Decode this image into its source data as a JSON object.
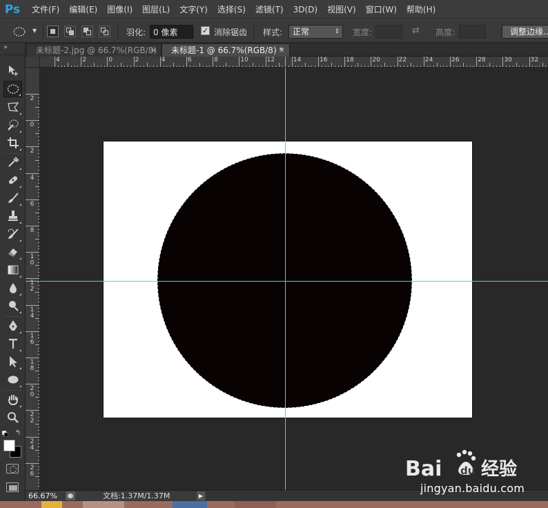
{
  "app": {
    "logo": "Ps"
  },
  "menu": [
    "文件(F)",
    "编辑(E)",
    "图像(I)",
    "图层(L)",
    "文字(Y)",
    "选择(S)",
    "滤镜(T)",
    "3D(D)",
    "视图(V)",
    "窗口(W)",
    "帮助(H)"
  ],
  "options": {
    "feather_label": "羽化:",
    "feather_value": "0 像素",
    "antialias_label": "消除锯齿",
    "antialias_checked": true,
    "style_label": "样式:",
    "style_value": "正常",
    "width_label": "宽度:",
    "height_label": "高度:",
    "refine_label": "调整边缘..."
  },
  "tabs": [
    {
      "label": "未标题-2.jpg @ 66.7%(RGB/8)",
      "active": false
    },
    {
      "label": "未标题-1 @ 66.7%(RGB/8) *",
      "active": true
    }
  ],
  "ruler": {
    "h_labels": [
      "4",
      "2",
      "0",
      "2",
      "4",
      "6",
      "8",
      "10",
      "12",
      "14",
      "16",
      "18",
      "20",
      "22",
      "24",
      "26",
      "28",
      "30",
      "32"
    ],
    "v_labels": [
      "2",
      "0",
      "2",
      "4",
      "6",
      "8",
      "10",
      "12",
      "14",
      "16",
      "18",
      "20",
      "22",
      "24",
      "26"
    ]
  },
  "statusbar": {
    "zoom": "66.67%",
    "doc_info": "文档:1.37M/1.37M"
  },
  "colors": {
    "foreground": "#ffffff",
    "background": "#000000",
    "guide": "#3fd6e6",
    "shape_fill": "#080202"
  },
  "watermark": {
    "logo_text": "Bai du 经验",
    "url": "jingyan.baidu.com"
  },
  "icons": {
    "tools": [
      "move-icon",
      "elliptical-marquee-icon",
      "lasso-icon",
      "quick-selection-icon",
      "crop-icon",
      "eyedropper-icon",
      "healing-brush-icon",
      "brush-icon",
      "clone-stamp-icon",
      "history-brush-icon",
      "eraser-icon",
      "gradient-icon",
      "blur-icon",
      "dodge-icon",
      "pen-icon",
      "type-icon",
      "path-selection-icon",
      "ellipse-shape-icon",
      "hand-icon",
      "zoom-icon"
    ]
  }
}
